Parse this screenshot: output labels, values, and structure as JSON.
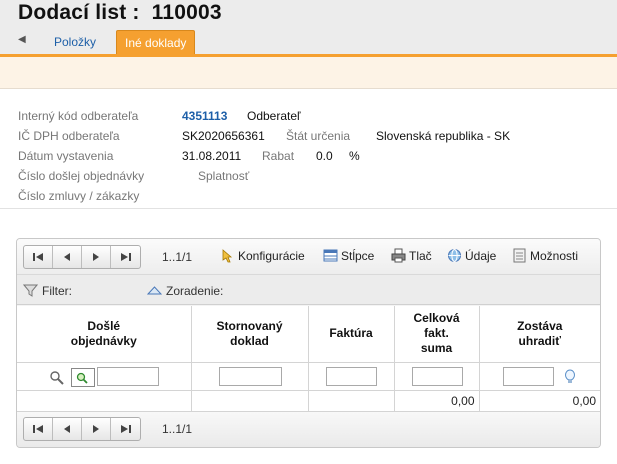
{
  "page": {
    "title": "Dodací list :  110003"
  },
  "tabs": [
    {
      "label": "Položky",
      "active": false
    },
    {
      "label": "Iné doklady",
      "active": true
    }
  ],
  "info": {
    "internal_code_label": "Interný kód odberateľa",
    "internal_code_value": "4351113",
    "customer_label": "Odberateľ",
    "vat_label": "IČ DPH odberateľa",
    "vat_value": "SK2020656361",
    "state_label": "Štát určenia",
    "state_value": "Slovenská republika - SK",
    "issue_date_label": "Dátum vystavenia",
    "issue_date_value": "31.08.2011",
    "discount_label": "Rabat",
    "discount_value": "0.0",
    "discount_unit": "%",
    "order_no_label": "Číslo došlej objednávky",
    "due_label": "Splatnosť",
    "contract_label": "Číslo zmluvy / zákazky"
  },
  "grid": {
    "pager_info": "1..1/1",
    "tools": {
      "config": "Konfigurácie",
      "columns": "Stĺpce",
      "print": "Tlač",
      "data": "Údaje",
      "options": "Možnosti"
    },
    "filter_label": "Filter:",
    "sort_label": "Zoradenie:",
    "columns": [
      {
        "line1": "Došlé",
        "line2": "objednávky",
        "line3": ""
      },
      {
        "line1": "Stornovaný",
        "line2": "doklad",
        "line3": ""
      },
      {
        "line1": "Faktúra",
        "line2": "",
        "line3": ""
      },
      {
        "line1": "Celková",
        "line2": "fakt.",
        "line3": "suma"
      },
      {
        "line1": "Zostáva",
        "line2": "uhradiť",
        "line3": ""
      }
    ],
    "totals": {
      "invoice_total": "0,00",
      "remaining": "0,00"
    }
  },
  "colors": {
    "accent": "#f5a030",
    "link": "#1d5fa8"
  },
  "icons": [
    "first-page-icon",
    "prev-page-icon",
    "next-page-icon",
    "last-page-icon",
    "config-icon",
    "columns-icon",
    "print-icon",
    "data-icon",
    "options-icon",
    "filter-icon",
    "sort-icon",
    "search-icon",
    "clear-filter-icon",
    "bulb-icon"
  ]
}
